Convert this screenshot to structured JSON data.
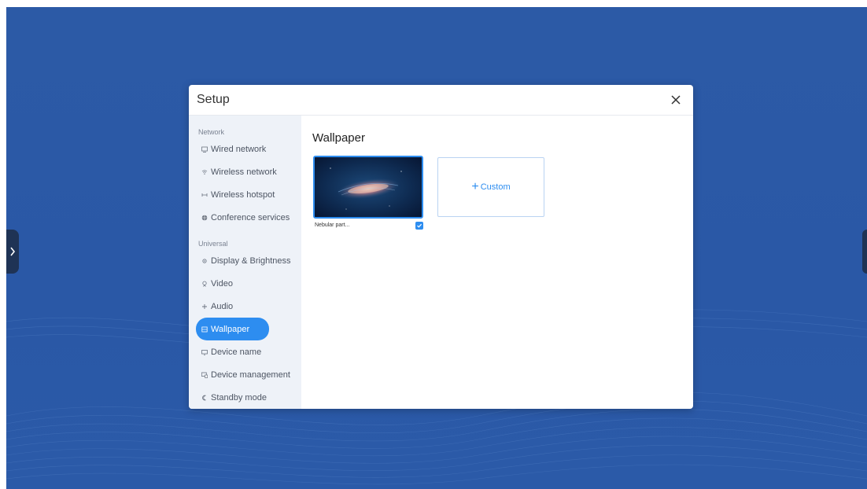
{
  "colors": {
    "background": "#2b59a6",
    "accent": "#2d8df0",
    "sidebar_bg": "#eef2f8"
  },
  "dialog": {
    "title": "Setup",
    "close_icon": "close-icon"
  },
  "sidebar": {
    "sections": [
      {
        "label": "Network",
        "items": [
          {
            "label": "Wired network",
            "icon": "monitor-icon"
          },
          {
            "label": "Wireless network",
            "icon": "wifi-icon"
          },
          {
            "label": "Wireless hotspot",
            "icon": "hotspot-icon"
          },
          {
            "label": "Conference services",
            "icon": "globe-icon"
          }
        ]
      },
      {
        "label": "Universal",
        "items": [
          {
            "label": "Display & Brightness",
            "icon": "brightness-icon"
          },
          {
            "label": "Video",
            "icon": "video-icon"
          },
          {
            "label": "Audio",
            "icon": "audio-icon"
          },
          {
            "label": "Wallpaper",
            "icon": "wallpaper-icon",
            "active": true
          },
          {
            "label": "Device name",
            "icon": "device-icon"
          },
          {
            "label": "Device management",
            "icon": "device-management-icon"
          },
          {
            "label": "Standby mode",
            "icon": "standby-icon"
          }
        ]
      }
    ]
  },
  "content": {
    "title": "Wallpaper",
    "wallpapers": [
      {
        "name": "Nebular part...",
        "selected": true
      }
    ],
    "custom_label": "Custom",
    "custom_icon": "plus-icon"
  },
  "side_tabs": {
    "left_icon": "chevron-right-icon"
  }
}
